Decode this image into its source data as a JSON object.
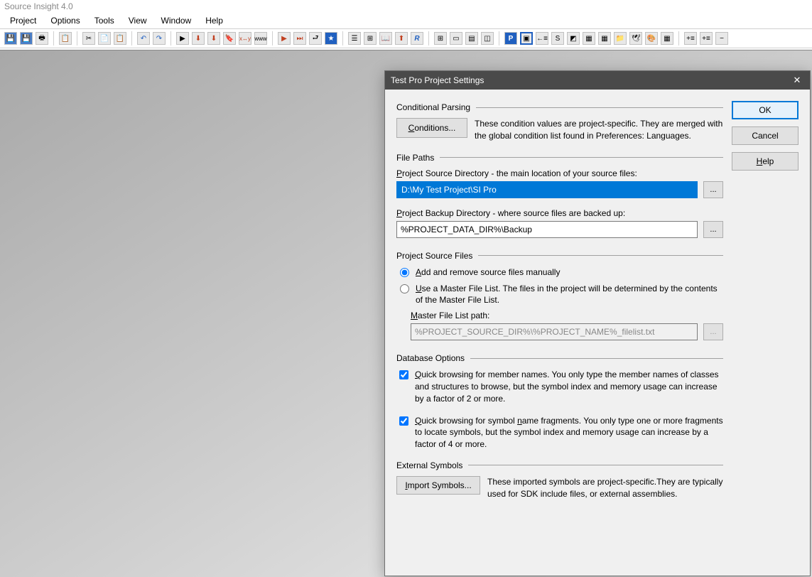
{
  "app_title": "Source Insight 4.0",
  "menu": [
    "Project",
    "Options",
    "Tools",
    "View",
    "Window",
    "Help"
  ],
  "dialog": {
    "title": "Test Pro Project Settings",
    "buttons": {
      "ok": "OK",
      "cancel": "Cancel",
      "help": "Help"
    },
    "conditional": {
      "heading": "Conditional Parsing",
      "btn": "Conditions...",
      "desc": "These condition values are project-specific.  They are merged with the global condition list found in Preferences: Languages."
    },
    "filepaths": {
      "heading": "File Paths",
      "src_label": "Project Source Directory - the main location of your source files:",
      "src_value": "D:\\My Test Project\\SI Pro",
      "bak_label": "Project Backup Directory - where source files are backed up:",
      "bak_value": "%PROJECT_DATA_DIR%\\Backup"
    },
    "srcfiles": {
      "heading": "Project Source Files",
      "opt_manual": "Add and remove source files manually",
      "opt_master": "Use a Master File List. The files in the project will be determined by the contents of the Master File List.",
      "master_label": "Master File List path:",
      "master_value": "%PROJECT_SOURCE_DIR%\\%PROJECT_NAME%_filelist.txt"
    },
    "db": {
      "heading": "Database Options",
      "quick_members": "Quick browsing for member names.  You only type the member names of classes and structures to browse, but the symbol index and memory usage can increase by a factor of 2 or more.",
      "quick_fragments": "Quick browsing for symbol name fragments.  You only type one or more fragments to locate symbols, but the symbol index and memory usage can increase by a factor of 4 or more."
    },
    "ext": {
      "heading": "External Symbols",
      "btn": "Import Symbols...",
      "desc": "These imported symbols are project-specific.They are typically used for SDK include files, or external assemblies."
    }
  }
}
